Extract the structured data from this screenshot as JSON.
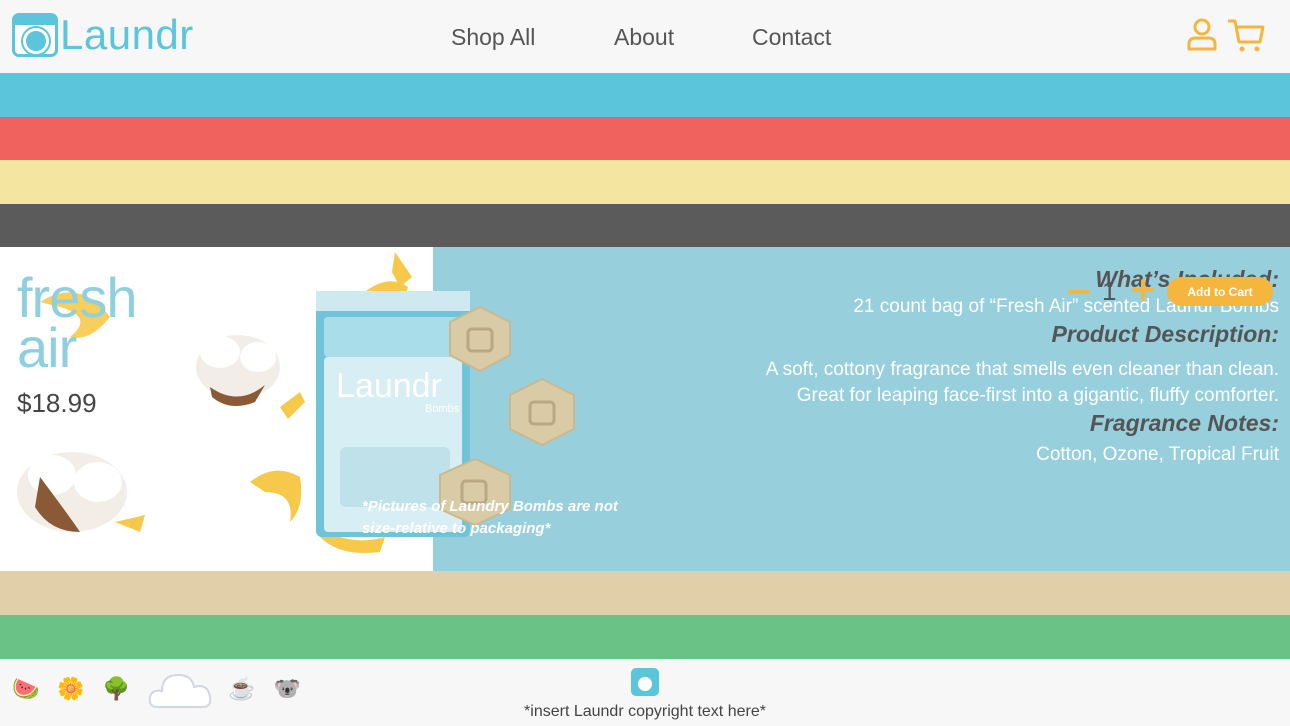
{
  "header": {
    "brand": "Laundr",
    "nav": [
      {
        "label": "Shop All"
      },
      {
        "label": "About"
      },
      {
        "label": "Contact"
      }
    ],
    "icons": [
      "user-icon",
      "cart-icon"
    ],
    "accent_color": "#f4b63d",
    "brand_color": "#5bc5dc"
  },
  "stripe_colors": [
    "#5bc5dc",
    "#ef625d",
    "#f4e6a0",
    "#5b5b5b",
    "#e1cfa9",
    "#6bc286"
  ],
  "product": {
    "name_line1": "fresh",
    "name_line2": "air",
    "price": "$18.99",
    "package_note": "*Pictures of Laundry Bombs are not size-relative to packaging*",
    "whats_included_heading": "What’s Included:",
    "whats_included": "21 count bag of “Fresh Air” scented Laundr Bombs",
    "description_heading": "Product Description:",
    "description": "A soft, cottony fragrance that smells even cleaner than clean. Great for leaping face-first into a gigantic, fluffy comforter.",
    "fragrance_heading": "Fragrance Notes:",
    "fragrance": "Cotton, Ozone, Tropical Fruit",
    "quantity": "1",
    "add_to_cart_label": "Add to Cart"
  },
  "footer": {
    "scent_icons": [
      "watermelon-icon",
      "flower-icon",
      "tree-icon",
      "cloud-icon",
      "coffee-icon",
      "koala-icon"
    ],
    "copyright": "*insert Laundr copyright text here*"
  }
}
